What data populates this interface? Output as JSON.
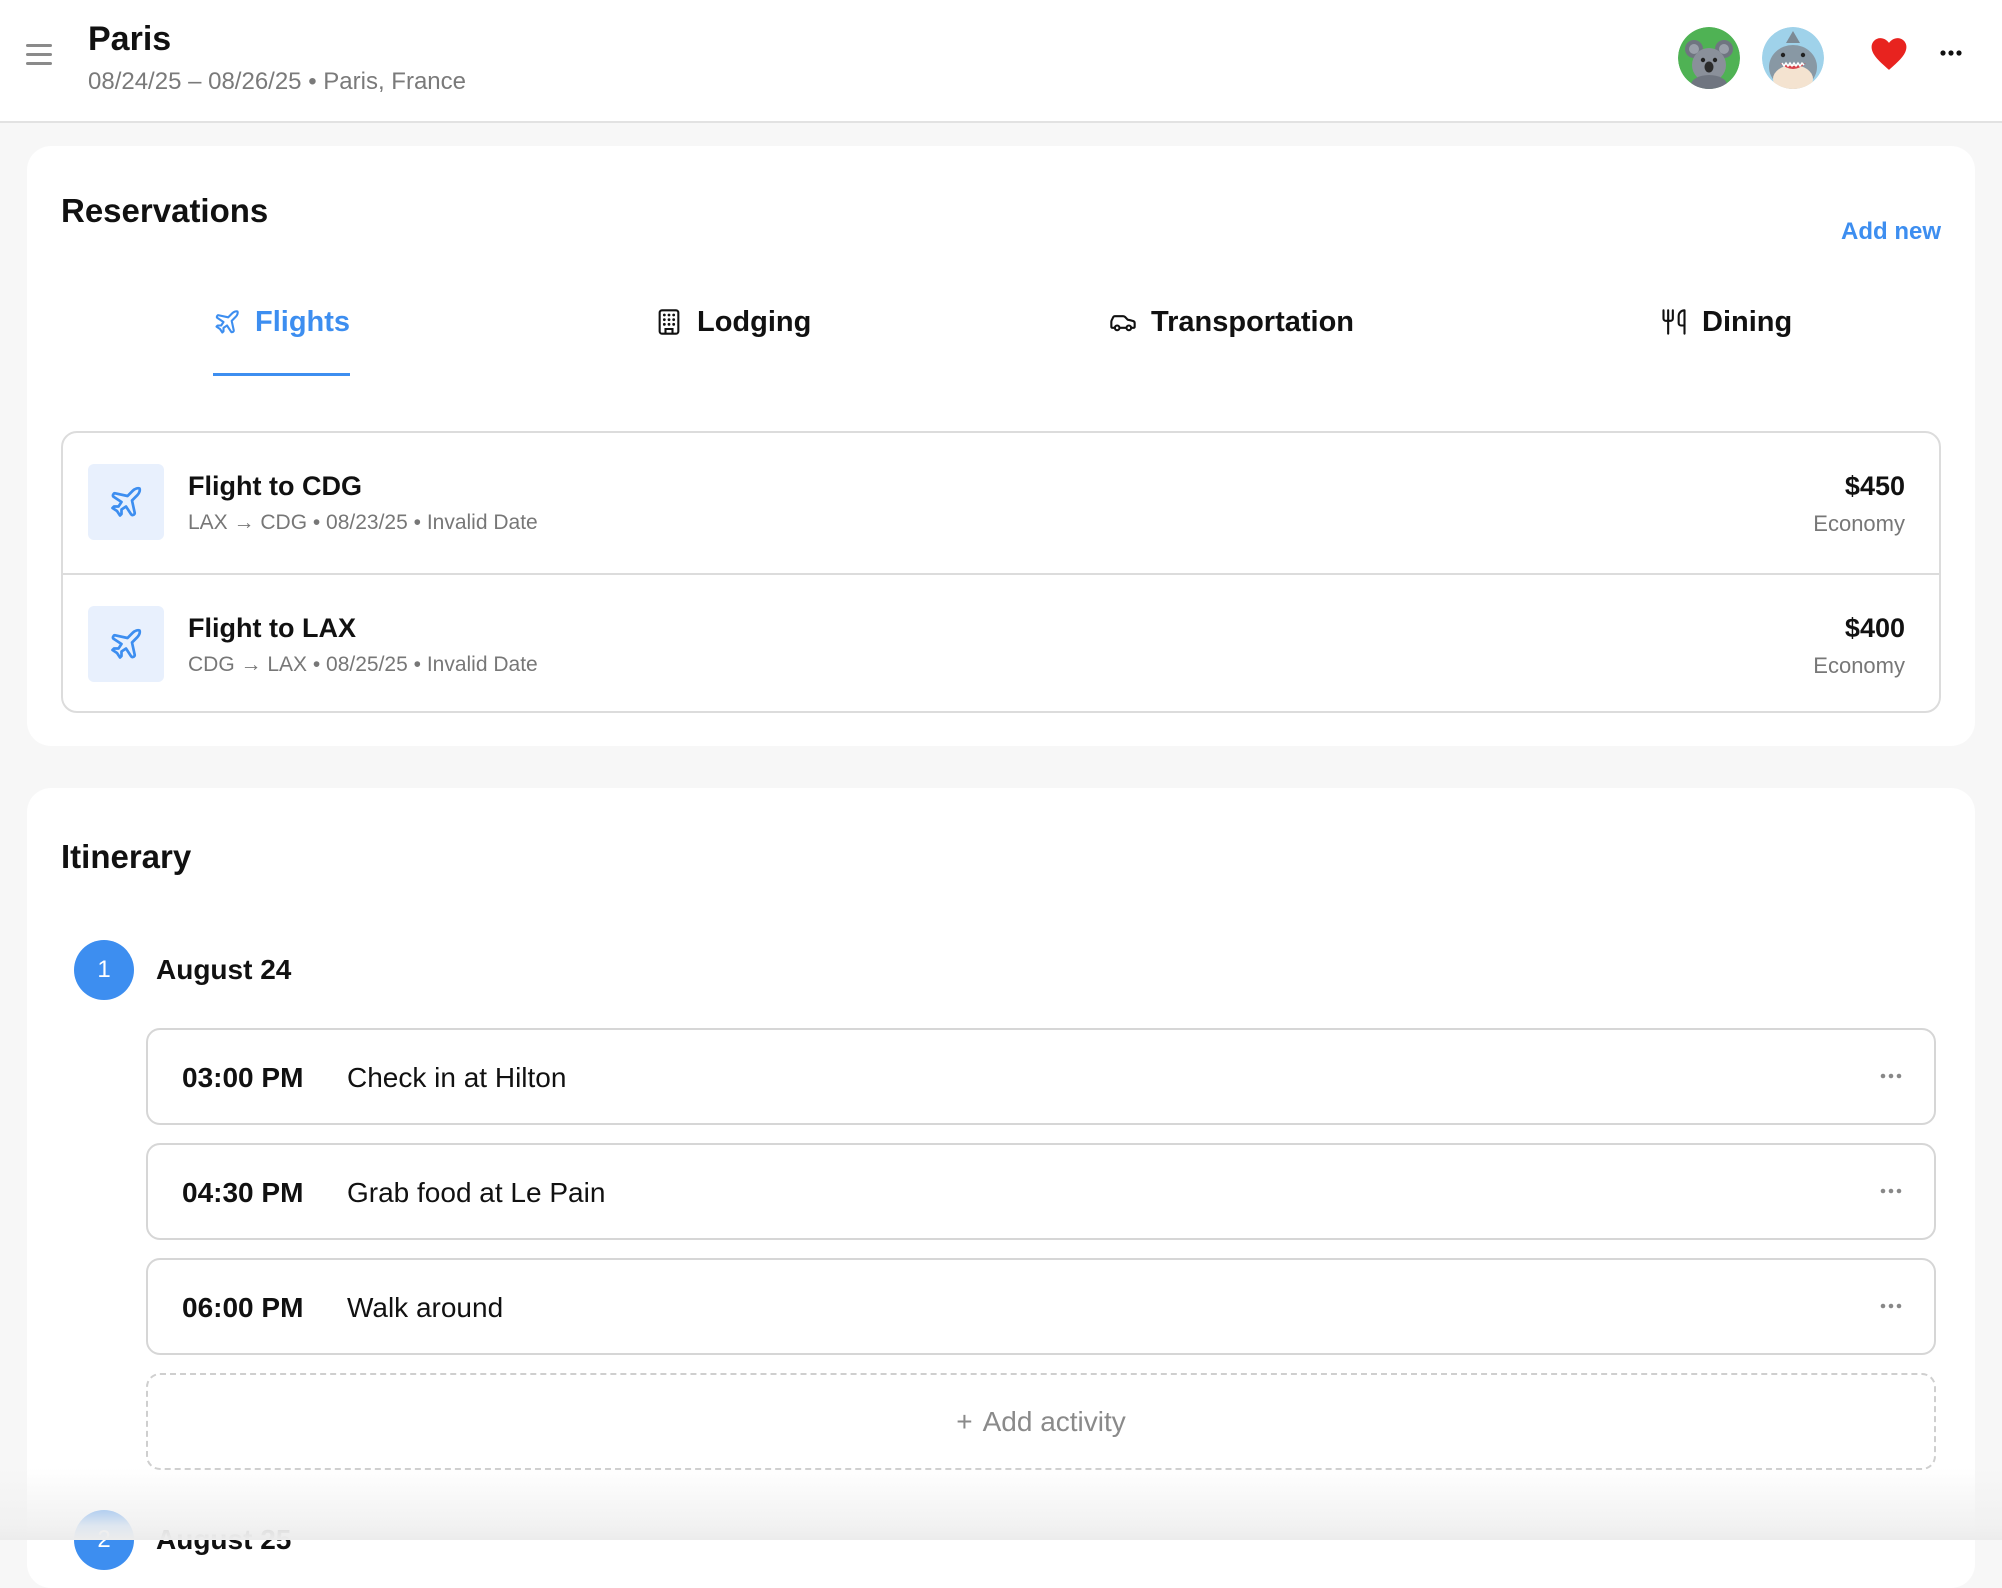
{
  "header": {
    "title": "Paris",
    "dates": "08/24/25 – 08/26/25",
    "separator": "•",
    "location": "Paris, France",
    "icons": [
      "menu-icon",
      "koala-avatar",
      "shark-avatar",
      "heart-icon",
      "more-icon"
    ],
    "heart_color": "#e8231f"
  },
  "reservations": {
    "title": "Reservations",
    "add_new_label": "Add new",
    "tabs": [
      {
        "label": "Flights",
        "icon": "plane-icon",
        "active": true
      },
      {
        "label": "Lodging",
        "icon": "building-icon",
        "active": false
      },
      {
        "label": "Transportation",
        "icon": "car-icon",
        "active": false
      },
      {
        "label": "Dining",
        "icon": "utensils-icon",
        "active": false
      }
    ],
    "items": [
      {
        "name": "Flight to CDG",
        "route": "LAX → CDG • 08/23/25 • Invalid Date",
        "price": "$450",
        "class": "Economy"
      },
      {
        "name": "Flight to LAX",
        "route": "CDG → LAX • 08/25/25 • Invalid Date",
        "price": "$400",
        "class": "Economy"
      }
    ]
  },
  "itinerary": {
    "title": "Itinerary",
    "days": [
      {
        "number": "1",
        "label": "August 24",
        "activities": [
          {
            "time": "03:00 PM",
            "title": "Check in at Hilton"
          },
          {
            "time": "04:30 PM",
            "title": "Grab food at Le Pain"
          },
          {
            "time": "06:00 PM",
            "title": "Walk around"
          }
        ],
        "add_label": "Add activity"
      },
      {
        "number": "2",
        "label": "August 25"
      }
    ]
  },
  "colors": {
    "accent": "#3d8ef0",
    "accent_light": "#e8f0fd",
    "muted_text": "#777777",
    "border": "#dcdcdc"
  }
}
